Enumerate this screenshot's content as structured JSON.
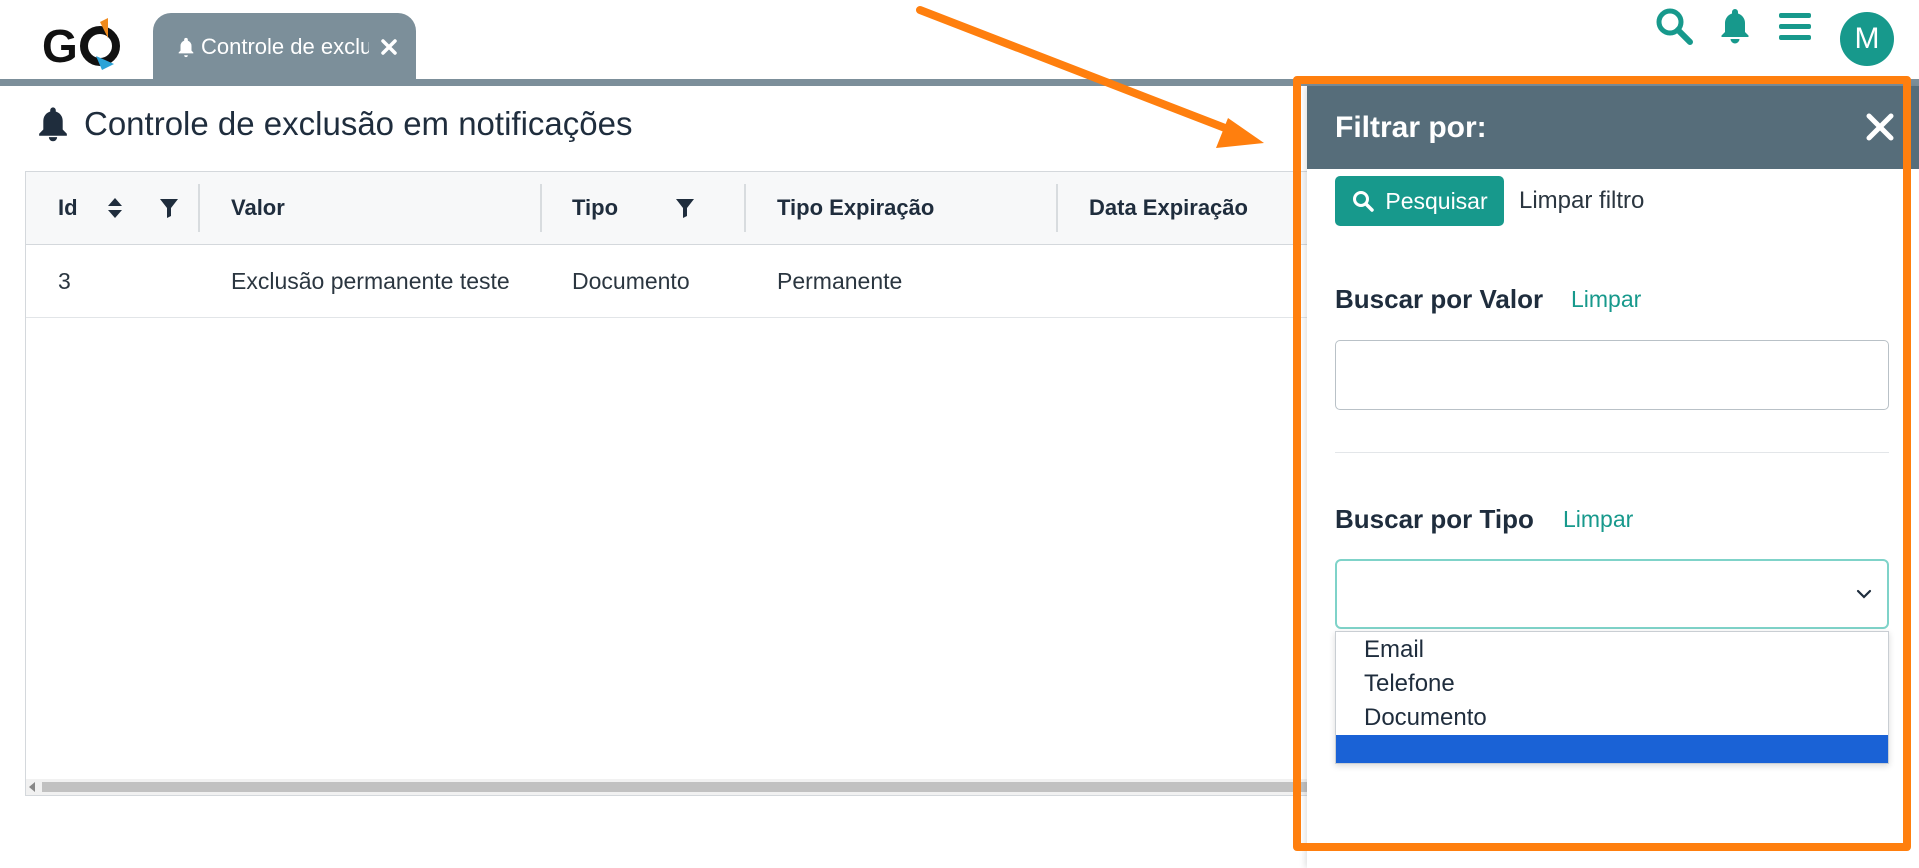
{
  "header": {
    "tab": {
      "label": "Controle de exclusão em notificações"
    },
    "avatar_initial": "M",
    "colors": {
      "accent": "#17998c",
      "tab_bg": "#7c8f9a"
    },
    "icons": [
      "search-icon",
      "bell-icon",
      "menu-icon"
    ]
  },
  "page": {
    "title": "Controle de exclusão em notificações"
  },
  "grid": {
    "columns": [
      "Id",
      "Valor",
      "Tipo",
      "Tipo Expiração",
      "Data Expiração"
    ],
    "rows": [
      {
        "id": "3",
        "valor": "Exclusão permanente teste",
        "tipo": "Documento",
        "tipo_expiracao": "Permanente",
        "data_expiracao": ""
      }
    ]
  },
  "filter_panel": {
    "title": "Filtrar por:",
    "search_button": "Pesquisar",
    "clear_all": "Limpar filtro",
    "valor": {
      "label": "Buscar por Valor",
      "clear": "Limpar",
      "value": ""
    },
    "tipo": {
      "label": "Buscar por Tipo",
      "clear": "Limpar",
      "selected": "",
      "options": [
        "Email",
        "Telefone",
        "Documento",
        ""
      ]
    }
  },
  "annotation_color": "#ff7f0e"
}
